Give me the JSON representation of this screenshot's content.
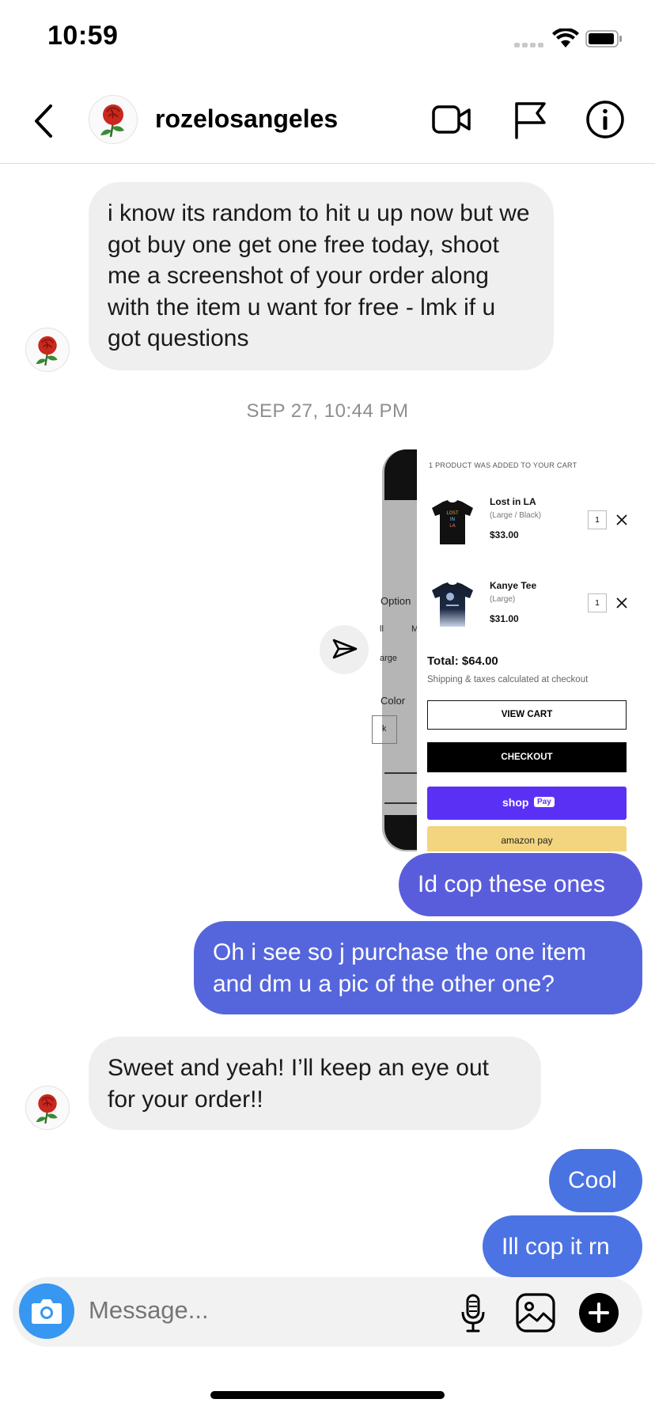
{
  "status_bar": {
    "time": "10:59"
  },
  "header": {
    "username": "rozelosangeles"
  },
  "messages": {
    "m1": "i know its random to hit u up now but we got buy one get one free today, shoot me a screenshot of your order along with the item u want for free - lmk if u got questions",
    "timestamp": "SEP 27, 10:44 PM",
    "m2": "Id cop these ones",
    "m3": "Oh i see so j purchase the one item and dm u a pic of the other one?",
    "m4": "Sweet and yeah! I’ll keep an eye out for your order!!",
    "m5": "Cool",
    "m6": "Ill cop it rn"
  },
  "screenshot": {
    "left_labels": [
      "Option",
      "ll",
      "M",
      "arge",
      "Color",
      "k"
    ],
    "banner": "1 PRODUCT WAS ADDED TO YOUR CART",
    "items": [
      {
        "name": "Lost in LA",
        "variant": "(Large / Black)",
        "price": "$33.00",
        "qty": "1"
      },
      {
        "name": "Kanye Tee",
        "variant": "(Large)",
        "price": "$31.00",
        "qty": "1"
      }
    ],
    "total": "Total: $64.00",
    "shipping_note": "Shipping & taxes calculated at checkout",
    "view_cart": "VIEW CART",
    "checkout": "CHECKOUT",
    "shop_pay_brand": "shop",
    "shop_pay_badge": "Pay",
    "amazon_pay": "amazon pay"
  },
  "composer": {
    "placeholder": "Message..."
  },
  "colors": {
    "outgoing_purple": "#5a5ddb",
    "outgoing_blue": "#4b73e3",
    "incoming": "#efefef",
    "shop_pay": "#5a31f4",
    "amazon_pay": "#f3d57f",
    "camera": "#3897f0"
  },
  "icons": [
    "back-icon",
    "video-call-icon",
    "flag-icon",
    "info-icon",
    "share-icon",
    "camera-icon",
    "microphone-icon",
    "gallery-icon",
    "add-icon",
    "rose-avatar-icon"
  ]
}
